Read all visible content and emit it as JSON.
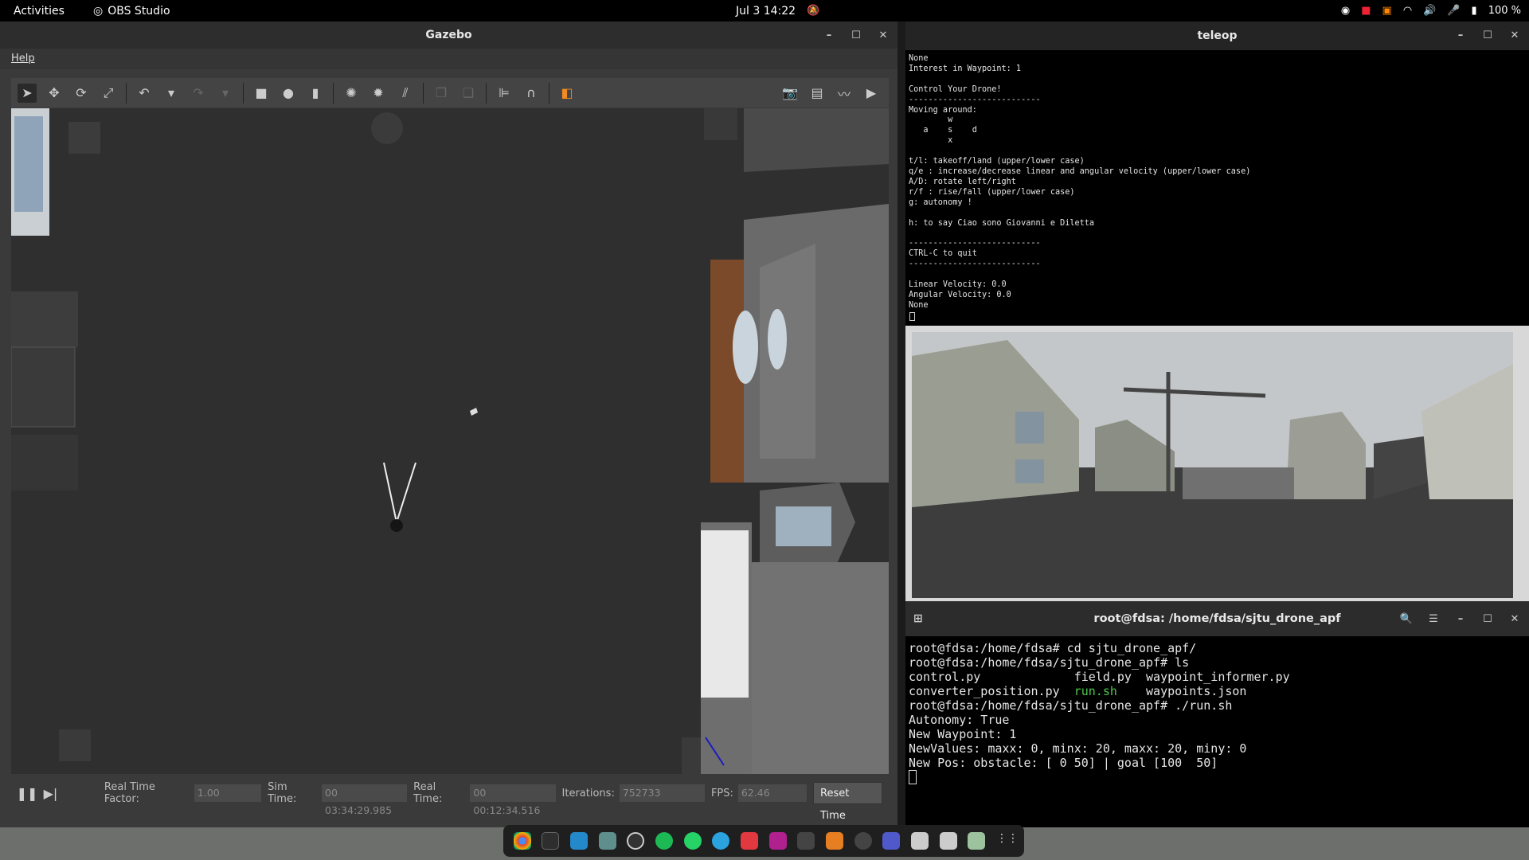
{
  "topbar": {
    "activities": "Activities",
    "app_name": "OBS Studio",
    "clock": "Jul 3  14:22",
    "battery": "100 %"
  },
  "gazebo": {
    "title": "Gazebo",
    "menu_help": "Help",
    "status": {
      "rtf_label": "Real Time Factor:",
      "rtf_value": "1.00",
      "sim_label": "Sim Time:",
      "sim_value": "00 03:34:29.985",
      "real_label": "Real Time:",
      "real_value": "00 00:12:34.516",
      "iter_label": "Iterations:",
      "iter_value": "752733",
      "fps_label": "FPS:",
      "fps_value": "62.46",
      "reset_label": "Reset Time"
    }
  },
  "teleop": {
    "title": "teleop",
    "text": "None\nInterest in Waypoint: 1\n\nControl Your Drone!\n---------------------------\nMoving around:\n        w\n   a    s    d\n        x\n\nt/l: takeoff/land (upper/lower case)\nq/e : increase/decrease linear and angular velocity (upper/lower case)\nA/D: rotate left/right\nr/f : rise/fall (upper/lower case)\ng: autonomy !\n\nh: to say Ciao sono Giovanni e Diletta\n\n---------------------------\nCTRL-C to quit\n---------------------------\n\nLinear Velocity: 0.0\nAngular Velocity: 0.0\nNone"
  },
  "terminal": {
    "title": "root@fdsa: /home/fdsa/sjtu_drone_apf",
    "line1": "root@fdsa:/home/fdsa# cd sjtu_drone_apf/",
    "line2": "root@fdsa:/home/fdsa/sjtu_drone_apf# ls",
    "ls1a": "control.py             field.py  waypoint_informer.py",
    "ls2a": "converter_position.py  ",
    "ls2b": "run.sh",
    "ls2c": "    waypoints.json",
    "line5": "root@fdsa:/home/fdsa/sjtu_drone_apf# ./run.sh",
    "line6": "Autonomy: True",
    "line7": "New Waypoint: 1",
    "line8": "NewValues: maxx: 0, minx: 20, maxx: 20, miny: 0",
    "line9": "New Pos: obstacle: [ 0 50] | goal [100  50]"
  }
}
